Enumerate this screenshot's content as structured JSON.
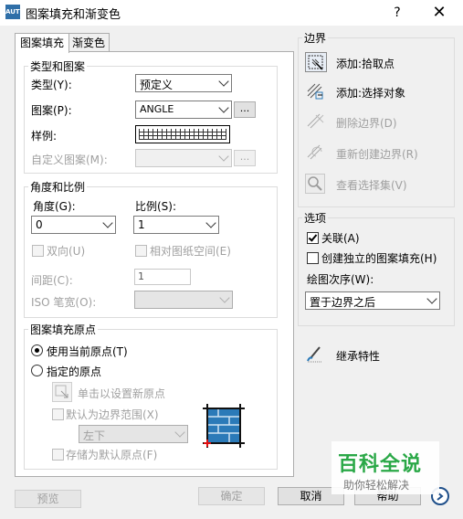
{
  "window": {
    "title": "图案填充和渐变色",
    "help": "?",
    "close": "✕",
    "app_icon": "AUTO"
  },
  "tabs": [
    {
      "label": "图案填充"
    },
    {
      "label": "渐变色"
    }
  ],
  "type_pattern": {
    "legend": "类型和图案",
    "type_label": "类型(Y):",
    "type_value": "预定义",
    "pattern_label": "图案(P):",
    "pattern_value": "ANGLE",
    "pattern_browse": "...",
    "sample_label": "样例:",
    "custom_label": "自定义图案(M):",
    "custom_browse": "..."
  },
  "angle_scale": {
    "legend": "角度和比例",
    "angle_label": "角度(G):",
    "angle_value": "0",
    "scale_label": "比例(S):",
    "scale_value": "1",
    "double_label": "双向(U)",
    "relative_label": "相对图纸空间(E)",
    "spacing_label": "间距(C):",
    "spacing_value": "1",
    "iso_label": "ISO 笔宽(O):"
  },
  "origin": {
    "legend": "图案填充原点",
    "use_current": "使用当前原点(T)",
    "specified": "指定的原点",
    "click_set": "单击以设置新原点",
    "default_extent": "默认为边界范围(X)",
    "extent_value": "左下",
    "store_default": "存储为默认原点(F)"
  },
  "boundary": {
    "legend": "边界",
    "add_pick": "添加:拾取点",
    "add_select": "添加:选择对象",
    "remove": "删除边界(D)",
    "recreate": "重新创建边界(R)",
    "view_sel": "查看选择集(V)"
  },
  "options": {
    "legend": "选项",
    "associative": "关联(A)",
    "independent": "创建独立的图案填充(H)",
    "draw_order_label": "绘图次序(W):",
    "draw_order_value": "置于边界之后"
  },
  "inherit": "继承特性",
  "footer": {
    "preview": "预览",
    "ok": "确定",
    "cancel": "取消",
    "help": "帮助"
  },
  "watermark": {
    "line1": "百科全说",
    "line2": "助你轻松解决"
  }
}
